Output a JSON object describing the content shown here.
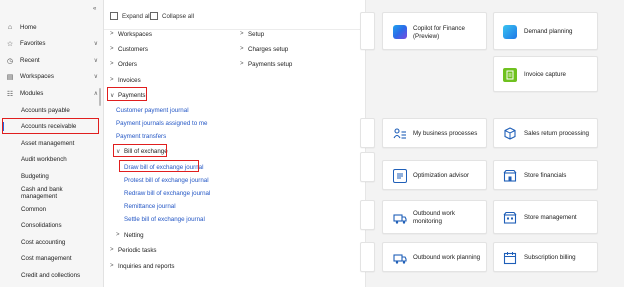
{
  "nav": {
    "items": [
      {
        "label": "Home",
        "icon": "home-icon"
      },
      {
        "label": "Favorites",
        "icon": "star-icon"
      },
      {
        "label": "Recent",
        "icon": "clock-icon"
      },
      {
        "label": "Workspaces",
        "icon": "workspaces-icon"
      },
      {
        "label": "Modules",
        "icon": "modules-icon"
      }
    ],
    "modules": [
      "Accounts payable",
      "Accounts receivable",
      "Asset management",
      "Audit workbench",
      "Budgeting",
      "Cash and bank management",
      "Common",
      "Consolidations",
      "Cost accounting",
      "Cost management",
      "Credit and collections"
    ],
    "selected_module": "Accounts receivable"
  },
  "flyout": {
    "expand_all": "Expand all",
    "collapse_all": "Collapse all",
    "left_column": {
      "workspaces": "Workspaces",
      "customers": "Customers",
      "orders": "Orders",
      "invoices": "Invoices",
      "payments": "Payments",
      "payment_links": [
        "Customer payment journal",
        "Payment journals assigned to me",
        "Payment transfers"
      ],
      "bill_of_exchange": "Bill of exchange",
      "bill_links": [
        "Draw bill of exchange journal",
        "Protest bill of exchange journal",
        "Redraw bill of exchange journal",
        "Remittance journal",
        "Settle bill of exchange journal"
      ],
      "netting": "Netting",
      "periodic_tasks": "Periodic tasks",
      "inquiries_reports": "Inquiries and reports"
    },
    "right_column": {
      "setup": "Setup",
      "charges_setup": "Charges setup",
      "payments_setup": "Payments setup"
    }
  },
  "tiles": {
    "copilot": "Copilot for Finance (Preview)",
    "demand_planning": "Demand planning",
    "invoice_capture": "Invoice capture",
    "my_business_processes": "My business processes",
    "sales_return_processing": "Sales return processing",
    "optimization_advisor": "Optimization advisor",
    "store_financials": "Store financials",
    "outbound_work_monitoring": "Outbound work monitoring",
    "store_management": "Store management",
    "outbound_work_planning": "Outbound work planning",
    "subscription_billing": "Subscription billing"
  },
  "colors": {
    "highlight_border": "#e01e1e",
    "link": "#2457c5",
    "tile_icon_blue": "#1f5fb8",
    "invoice_green": "#6fc11f"
  }
}
